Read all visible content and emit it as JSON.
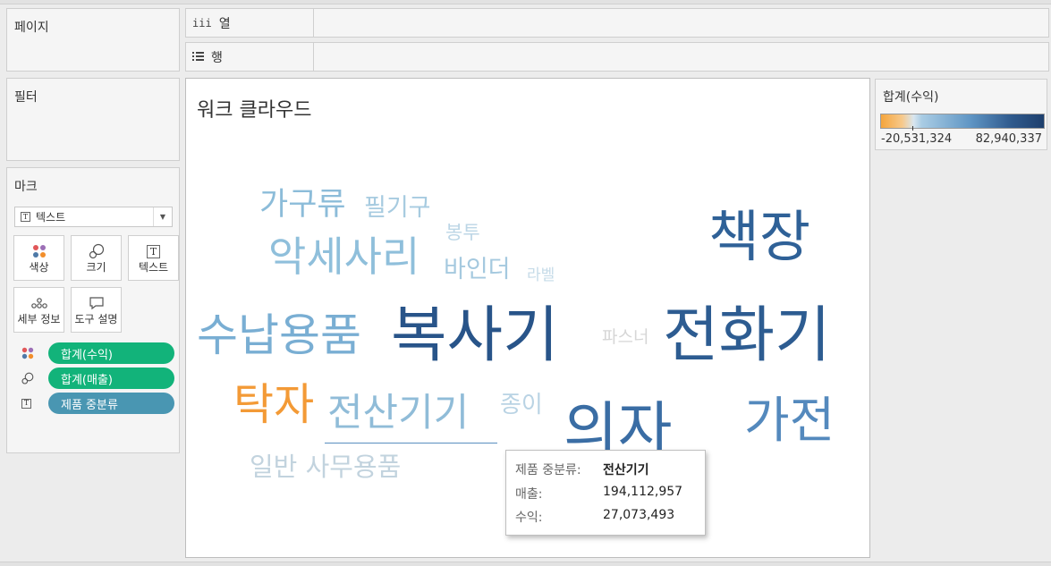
{
  "pages_card": {
    "title": "페이지"
  },
  "columns_shelf": {
    "icon": "columns-icon",
    "label": "열"
  },
  "rows_shelf": {
    "icon": "rows-icon",
    "label": "행"
  },
  "filters_card": {
    "title": "필터"
  },
  "marks_card": {
    "title": "마크",
    "mark_type": "텍스트",
    "buttons": [
      {
        "icon": "color-icon",
        "label": "색상"
      },
      {
        "icon": "size-icon",
        "label": "크기"
      },
      {
        "icon": "text-icon",
        "label": "텍스트"
      },
      {
        "icon": "detail-icon",
        "label": "세부 정보"
      },
      {
        "icon": "tooltip-icon",
        "label": "도구 설명"
      }
    ],
    "pills": [
      {
        "icon": "color-icon",
        "label": "합계(수익)",
        "color": "#12b37a"
      },
      {
        "icon": "size-icon",
        "label": "합계(매출)",
        "color": "#12b37a"
      },
      {
        "icon": "text-icon",
        "label": "제품 중분류",
        "color": "#4996b2"
      }
    ]
  },
  "viz": {
    "title": "워크 클라우드",
    "words": [
      {
        "text": "가구류",
        "color": "#8cbcd9"
      },
      {
        "text": "필기구",
        "color": "#a7cbe0"
      },
      {
        "text": "봉투",
        "color": "#bcd6e6"
      },
      {
        "text": "악세사리",
        "color": "#8fbfdb"
      },
      {
        "text": "바인더",
        "color": "#a5c9df"
      },
      {
        "text": "라벨",
        "color": "#c6dbe8"
      },
      {
        "text": "책장",
        "color": "#2f6197"
      },
      {
        "text": "수납용품",
        "color": "#79aed3"
      },
      {
        "text": "복사기",
        "color": "#285489"
      },
      {
        "text": "파스너",
        "color": "#d6d6d6"
      },
      {
        "text": "전화기",
        "color": "#2d5c91"
      },
      {
        "text": "탁자",
        "color": "#f39a36"
      },
      {
        "text": "전산기기",
        "color": "#90bcd8"
      },
      {
        "text": "종이",
        "color": "#b9d3e4"
      },
      {
        "text": "의자",
        "color": "#3a6da4"
      },
      {
        "text": "가전",
        "color": "#5489bd"
      },
      {
        "text": "일반 사무용품",
        "color": "#c2d3de"
      }
    ]
  },
  "legend": {
    "title": "합계(수익)",
    "min": "-20,531,324",
    "max": "82,940,337"
  },
  "tooltip": {
    "category_label": "제품 중분류:",
    "category_value": "전산기기",
    "sales_label": "매출:",
    "sales_value": "194,112,957",
    "profit_label": "수익:",
    "profit_value": "27,073,493"
  }
}
